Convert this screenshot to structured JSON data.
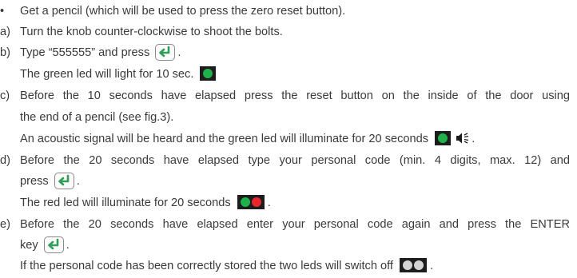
{
  "lines": [
    {
      "marker": "•",
      "text": "Get a pencil (which will be used to press the zero reset button)."
    },
    {
      "marker": "a)",
      "text": "Turn the knob counter-clockwise to shoot the bolts."
    },
    {
      "marker": "b)",
      "text_a": "Type “555555” and press",
      "text_b": "."
    },
    {
      "text": "The green led will light for 10 sec."
    },
    {
      "marker": "c)",
      "text": "Before the 10 seconds have elapsed press the reset button on the inside of the door using"
    },
    {
      "text": "the end of a pencil (see fig.3)."
    },
    {
      "text": "An acoustic signal will be heard and the green led will illuminate for 20 seconds",
      "text_b": "."
    },
    {
      "marker": "d)",
      "text": "Before the 20 seconds have elapsed type your personal code (min. 4 digits, max. 12) and"
    },
    {
      "text_a": "press",
      "text_b": "."
    },
    {
      "text_a": "The red led will illuminate for 20 seconds",
      "text_b": "."
    },
    {
      "marker": "e)",
      "text": "Before the 20 seconds have elapsed enter your personal code again and press the ENTER"
    },
    {
      "text_a": "key",
      "text_b": "."
    },
    {
      "text_a": "If the personal code has been correctly stored the two leds will switch off",
      "text_b": "."
    }
  ],
  "colors": {
    "led_green": "#1fb24a",
    "led_red": "#e8262e",
    "led_off": "#d4d4d4",
    "text": "#3a3a3a"
  },
  "icons": [
    "enter-key-icon",
    "green-led-icon",
    "speaker-icon",
    "red-green-led-icon",
    "leds-off-icon"
  ]
}
